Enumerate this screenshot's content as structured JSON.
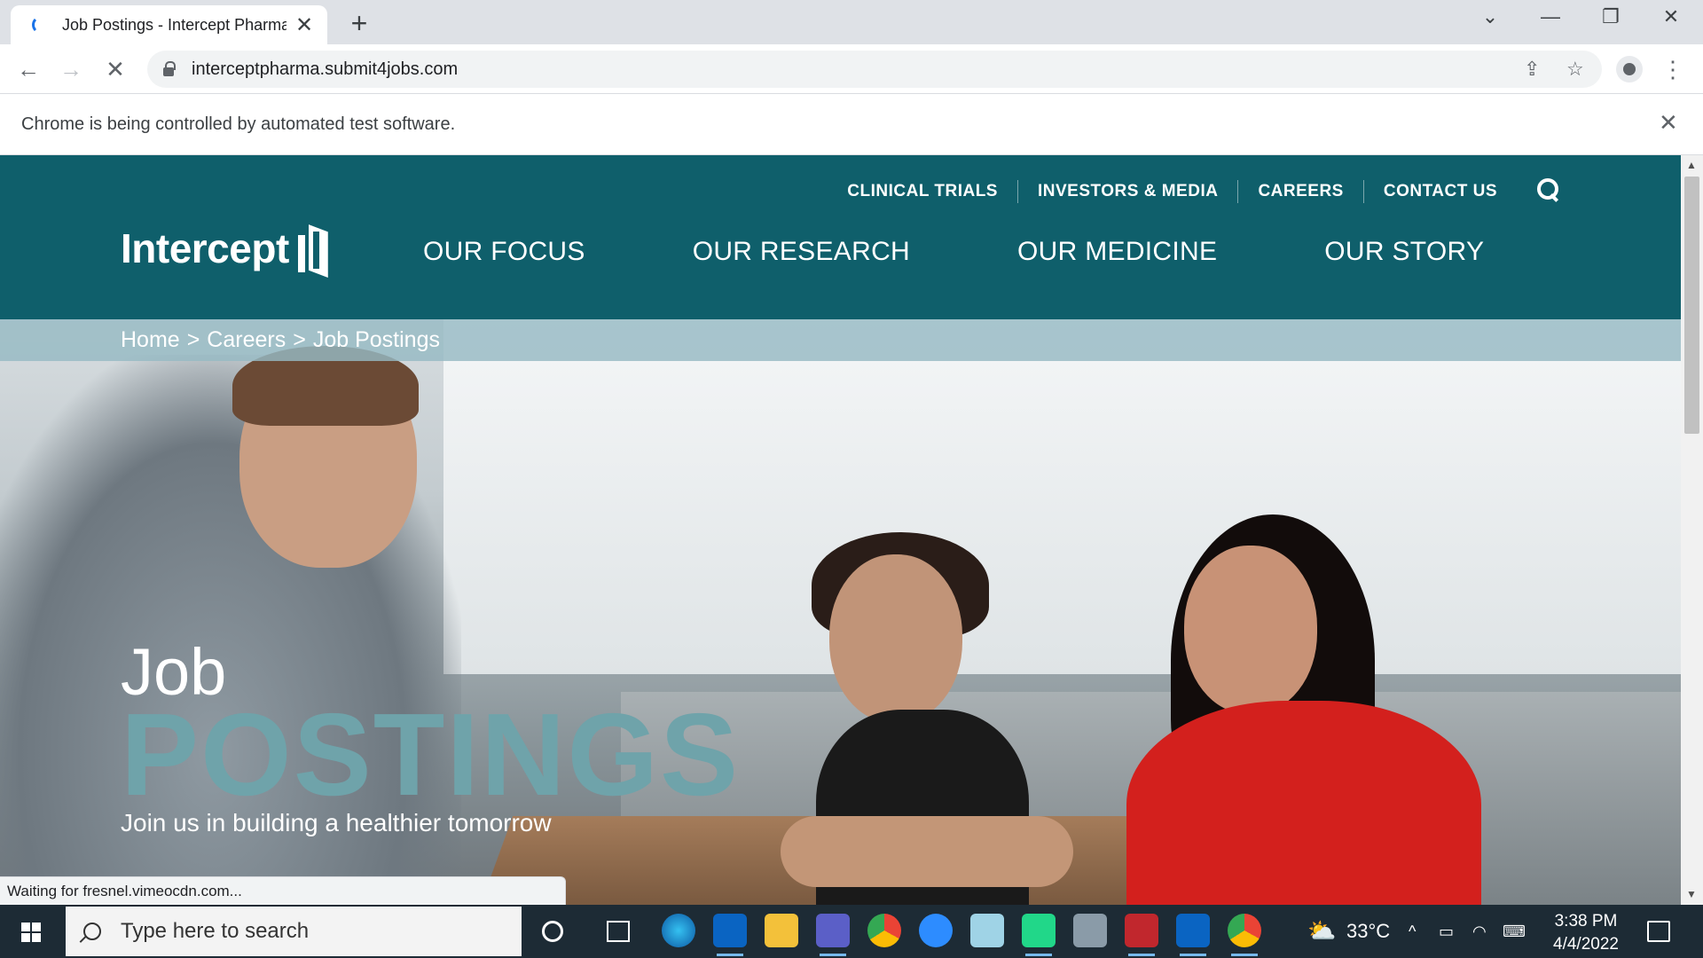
{
  "browser": {
    "tab_title": "Job Postings - Intercept Pharmac",
    "tab_close": "✕",
    "new_tab": "+",
    "url": "interceptpharma.submit4jobs.com",
    "infobar_text": "Chrome is being controlled by automated test software.",
    "infobar_close": "✕",
    "status_text": "Waiting for fresnel.vimeocdn.com..."
  },
  "site": {
    "logo_text": "Intercept",
    "utility_nav": [
      "CLINICAL TRIALS",
      "INVESTORS & MEDIA",
      "CAREERS",
      "CONTACT US"
    ],
    "main_nav": [
      "OUR FOCUS",
      "OUR RESEARCH",
      "OUR MEDICINE",
      "OUR STORY"
    ],
    "breadcrumb": [
      "Home",
      "Careers",
      "Job Postings"
    ],
    "breadcrumb_sep": ">",
    "hero_title_small": "Job",
    "hero_title_large": "POSTINGS",
    "hero_subtitle": "Join us in building a healthier tomorrow"
  },
  "taskbar": {
    "search_placeholder": "Type here to search",
    "weather": "33°C",
    "time": "3:38 PM",
    "date": "4/4/2022"
  },
  "colors": {
    "header_teal": "#0f5f6b",
    "postings_teal": "#6fa3aa",
    "taskbar": "#1d2b35"
  }
}
